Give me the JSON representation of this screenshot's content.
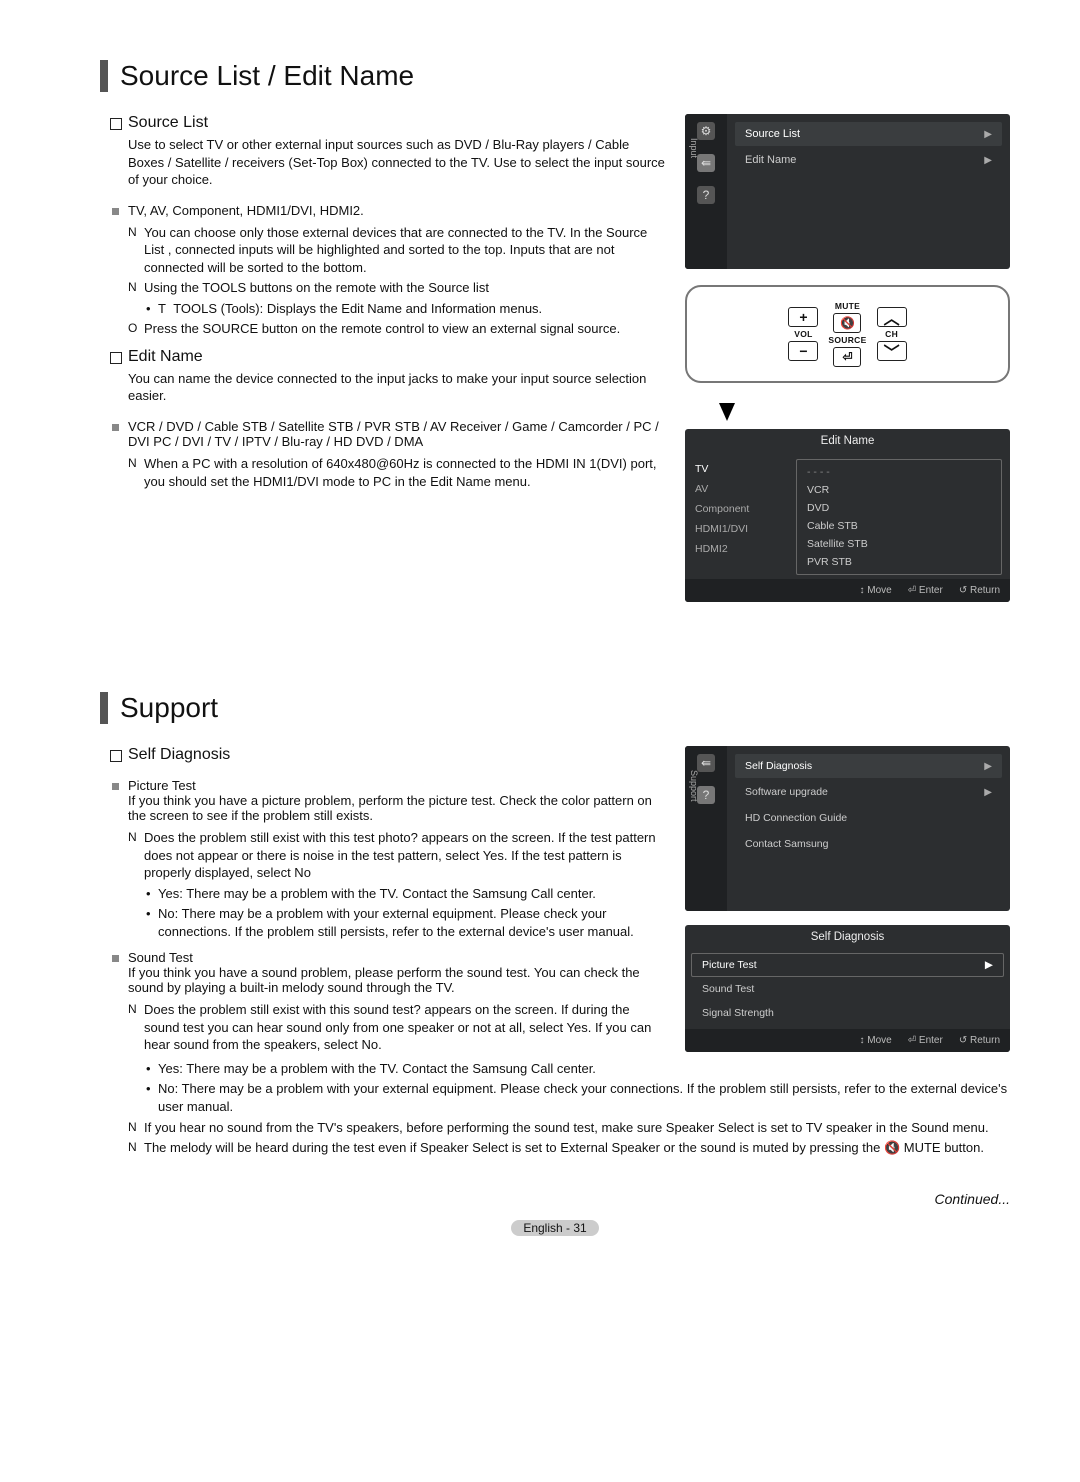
{
  "section1": {
    "title": "Source List / Edit Name",
    "sourceList": {
      "heading": "Source List",
      "desc": "Use to select TV or other external input sources such as DVD / Blu-Ray players / Cable Boxes / Satellite / receivers (Set-Top Box) connected to the TV. Use to select the input source of your choice.",
      "inputs": "TV, AV, Component, HDMI1/DVI, HDMI2.",
      "note1": "You can choose only those external devices that are connected to the TV. In the Source List , connected inputs will be highlighted and sorted to the top. Inputs that are not connected will be sorted to the bottom.",
      "note2": "Using the TOOLS buttons on the remote with the Source list",
      "toolsBullet": "TOOLS (Tools): Displays the Edit Name  and Information   menus.",
      "tip1": "Press the SOURCE button on the remote control to view an external signal source."
    },
    "editName": {
      "heading": "Edit Name",
      "desc": "You can name the device connected to the input jacks to make your input source selection easier.",
      "devices": "VCR / DVD / Cable STB / Satellite STB / PVR STB / AV Receiver / Game / Camcorder / PC / DVI PC / DVI / TV / IPTV / Blu-ray / HD DVD / DMA",
      "note1": "When a PC with a resolution of 640x480@60Hz is connected to the HDMI IN 1(DVI) port, you should set the HDMI1/DVI mode to PC in the Edit Name menu."
    },
    "osd1": {
      "tabLabel": "Input",
      "items": [
        "Source List",
        "Edit Name"
      ]
    },
    "remote": {
      "mute": "MUTE",
      "vol": "VOL",
      "source": "SOURCE",
      "ch": "CH"
    },
    "osd2": {
      "title": "Edit Name",
      "left": [
        "TV",
        "AV",
        "Component",
        "HDMI1/DVI",
        "HDMI2"
      ],
      "right": [
        "- - - -",
        "VCR",
        "DVD",
        "Cable STB",
        "Satellite STB",
        "PVR STB"
      ],
      "foot": [
        "Move",
        "Enter",
        "Return"
      ]
    }
  },
  "section2": {
    "title": "Support",
    "selfDiag": {
      "heading": "Self Diagnosis",
      "pictureTest": {
        "label": "Picture Test",
        "desc": "If you think you have a picture problem, perform the picture test. Check the color pattern on the screen to see if the problem still exists.",
        "note1": "Does the problem still exist with this test photo?        appears on the screen. If the test pattern does not appear or there is noise in the test pattern, select Yes. If the test pattern is properly displayed, select No",
        "yes": "Yes: There may be a problem with the TV. Contact the Samsung Call center.",
        "no": "No: There may be a problem with your external equipment. Please check your connections. If the problem still persists, refer to the external device's user manual."
      },
      "soundTest": {
        "label": "Sound Test",
        "desc": "If you think you have a sound problem, please perform the sound test. You can check the sound by playing a built-in melody sound through the TV.",
        "note1": "Does the problem still exist with this sound test?        appears on the screen. If during the sound test you can hear sound only from one speaker or not at all, select Yes. If you can hear sound from the speakers, select No.",
        "yes": "Yes: There may be a problem with the TV. Contact the Samsung Call center.",
        "no": "No: There may be a problem with your external equipment. Please check your connections. If the problem still persists, refer to the external device's user manual.",
        "note2": "If you hear no sound from the TV's speakers, before performing the sound test, make sure Speaker Select  is set to TV speaker in the Sound menu.",
        "note3": "The melody will be heard during the test even if Speaker Select  is set to External Speaker  or the sound is muted by pressing the 🔇 MUTE button."
      }
    },
    "osd3": {
      "tabLabel": "Support",
      "items": [
        "Self Diagnosis",
        "Software upgrade",
        "HD Connection Guide",
        "Contact Samsung"
      ]
    },
    "osd4": {
      "title": "Self Diagnosis",
      "items": [
        "Picture Test",
        "Sound Test",
        "Signal Strength"
      ],
      "foot": [
        "Move",
        "Enter",
        "Return"
      ]
    }
  },
  "continued": "Continued...",
  "footer": "English - 31",
  "markers": {
    "N": "N",
    "O": "O",
    "T": "T"
  }
}
